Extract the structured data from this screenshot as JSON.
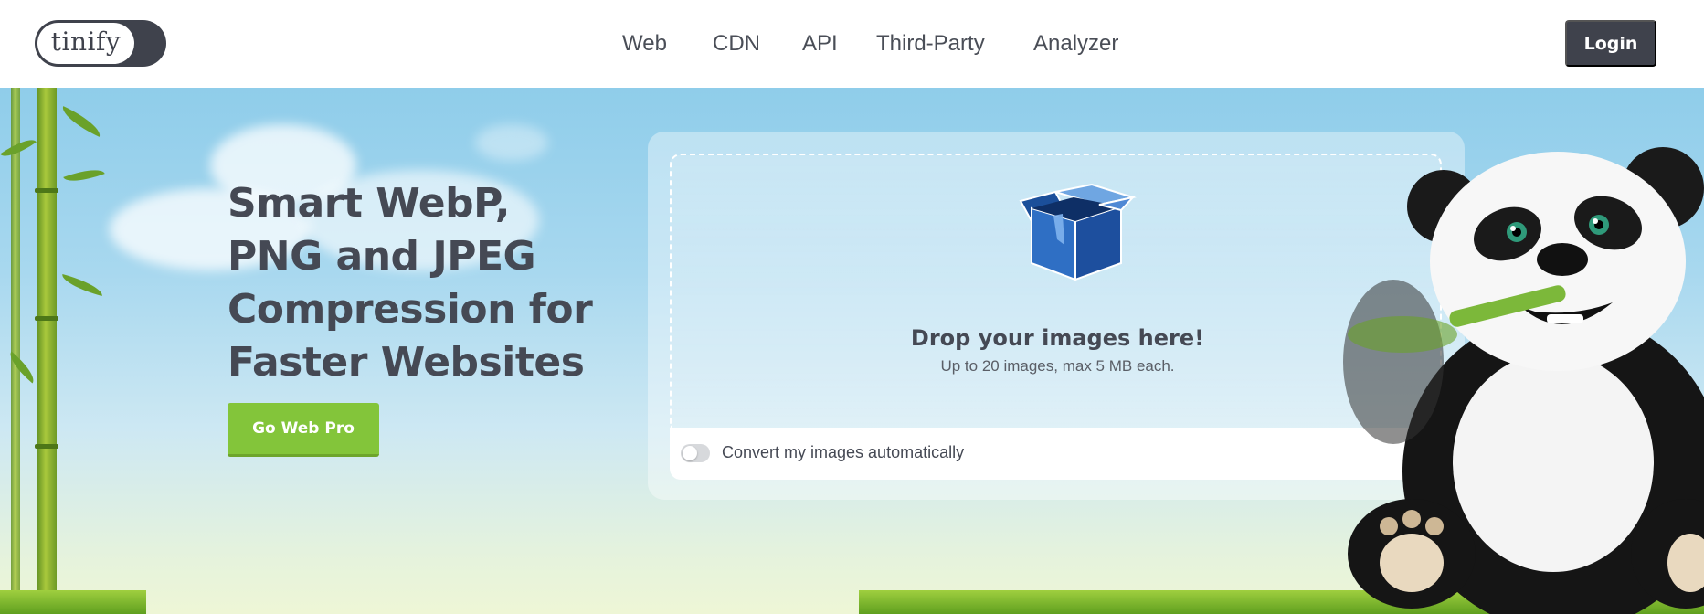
{
  "header": {
    "logo_text": "tinify",
    "nav": [
      {
        "label": "Web"
      },
      {
        "label": "CDN"
      },
      {
        "label": "API"
      },
      {
        "label": "Third-Party"
      },
      {
        "label": "Analyzer"
      }
    ],
    "login_label": "Login"
  },
  "hero": {
    "headline": "Smart WebP, PNG and JPEG Compression for Faster Websites",
    "cta_label": "Go Web Pro",
    "cta_color": "#83c53a"
  },
  "dropzone": {
    "title": "Drop your images here!",
    "subtitle": "Up to 20 images, max 5 MB each.",
    "box_icon": "box-icon",
    "convert_toggle_label": "Convert my images automatically",
    "convert_toggle_on": false
  },
  "colors": {
    "brand_dark": "#3f424c",
    "sky": "#8fcdea",
    "text": "#454954"
  }
}
